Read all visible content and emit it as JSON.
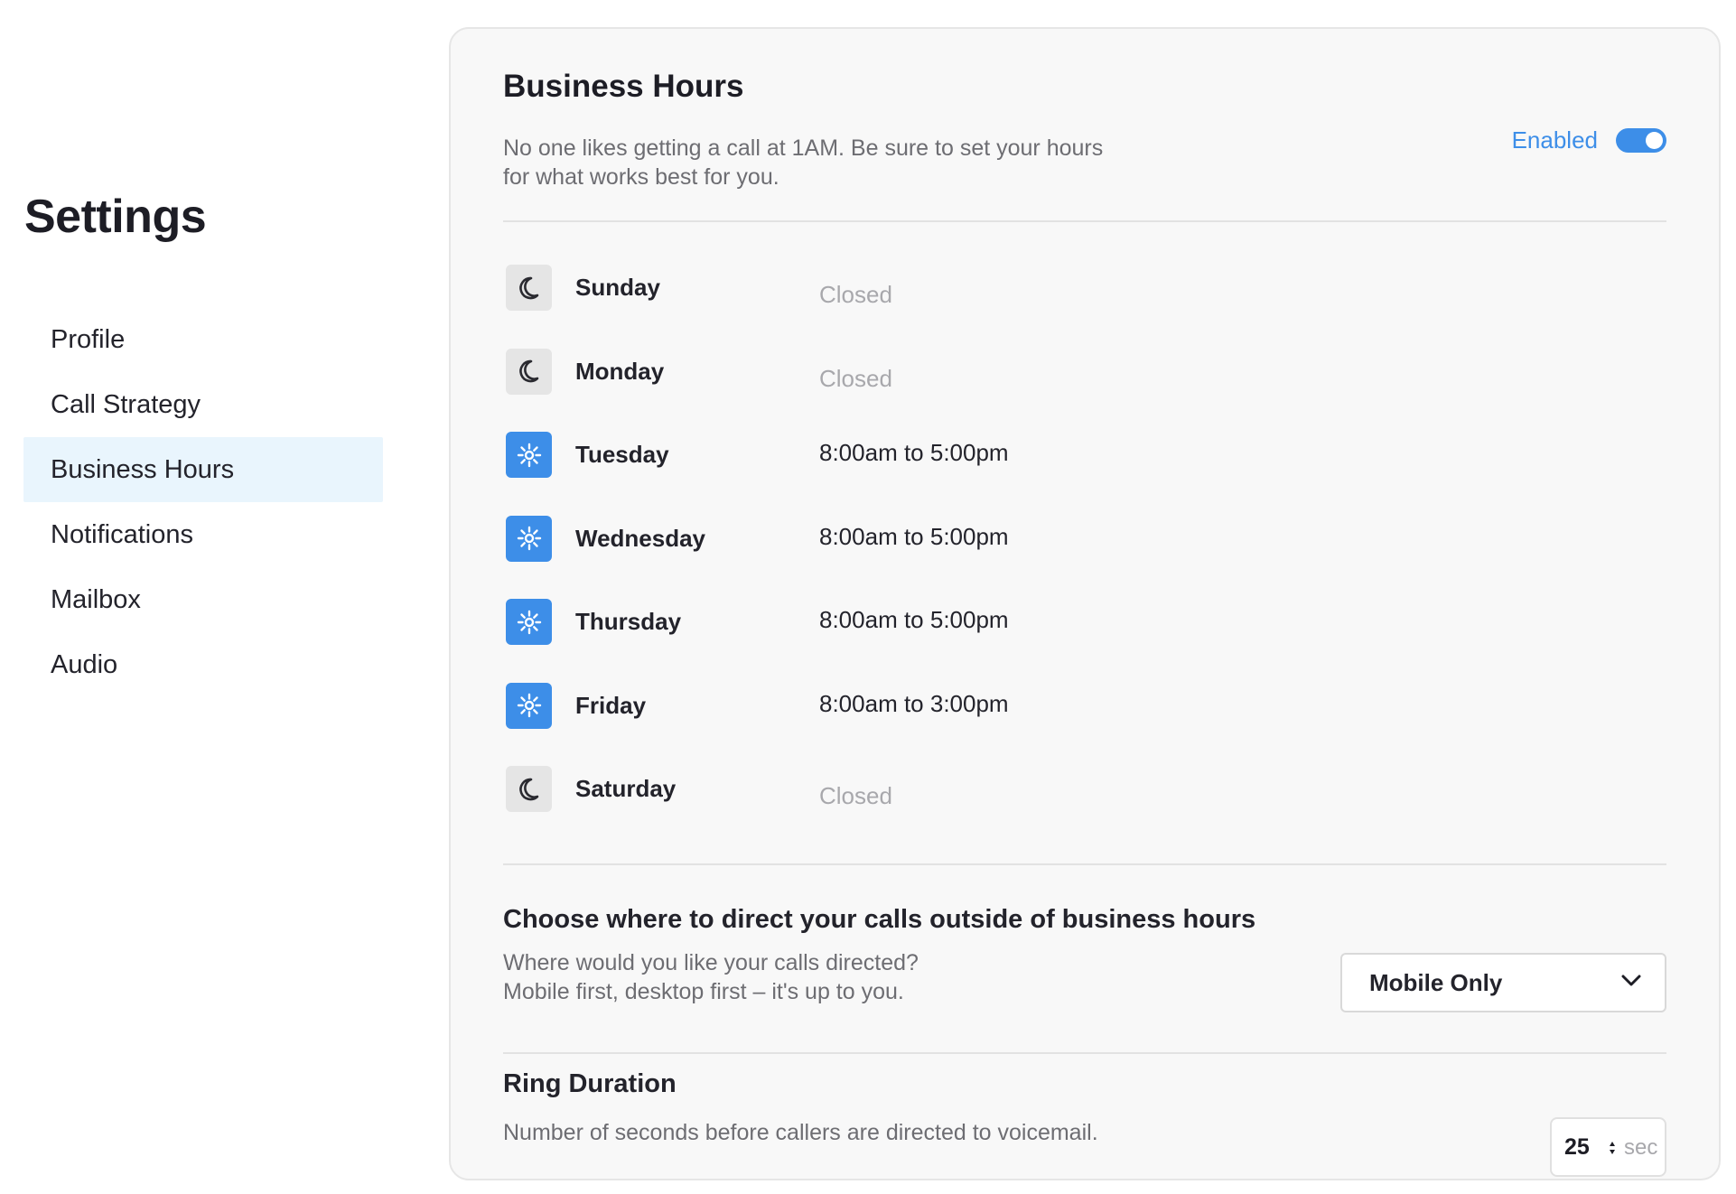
{
  "sidebar": {
    "title": "Settings",
    "items": [
      {
        "label": "Profile",
        "active": false
      },
      {
        "label": "Call Strategy",
        "active": false
      },
      {
        "label": "Business Hours",
        "active": true
      },
      {
        "label": "Notifications",
        "active": false
      },
      {
        "label": "Mailbox",
        "active": false
      },
      {
        "label": "Audio",
        "active": false
      }
    ]
  },
  "business_hours": {
    "title": "Business Hours",
    "description": "No one likes getting a call at 1AM. Be sure to set your hours for what works best for you.",
    "enabled_label": "Enabled",
    "enabled": true,
    "days": [
      {
        "name": "Sunday",
        "hours": "Closed",
        "open": false,
        "icon": "moon-icon"
      },
      {
        "name": "Monday",
        "hours": "Closed",
        "open": false,
        "icon": "moon-icon"
      },
      {
        "name": "Tuesday",
        "hours": "8:00am to 5:00pm",
        "open": true,
        "icon": "sun-icon"
      },
      {
        "name": "Wednesday",
        "hours": "8:00am to 5:00pm",
        "open": true,
        "icon": "sun-icon"
      },
      {
        "name": "Thursday",
        "hours": "8:00am to 5:00pm",
        "open": true,
        "icon": "sun-icon"
      },
      {
        "name": "Friday",
        "hours": "8:00am to 3:00pm",
        "open": true,
        "icon": "sun-icon"
      },
      {
        "name": "Saturday",
        "hours": "Closed",
        "open": false,
        "icon": "moon-icon"
      }
    ]
  },
  "after_hours": {
    "title": "Choose where to direct your calls outside of business hours",
    "description_line1": "Where would you like your calls directed?",
    "description_line2": "Mobile first, desktop first – it's up to you.",
    "selected": "Mobile Only"
  },
  "ring_duration": {
    "title": "Ring Duration",
    "description": "Number of seconds before callers are directed to voicemail.",
    "value": "25",
    "unit": "sec"
  },
  "colors": {
    "accent": "#3d8ee8",
    "active_nav_bg": "#e9f5fd",
    "card_bg": "#f8f8f8"
  }
}
